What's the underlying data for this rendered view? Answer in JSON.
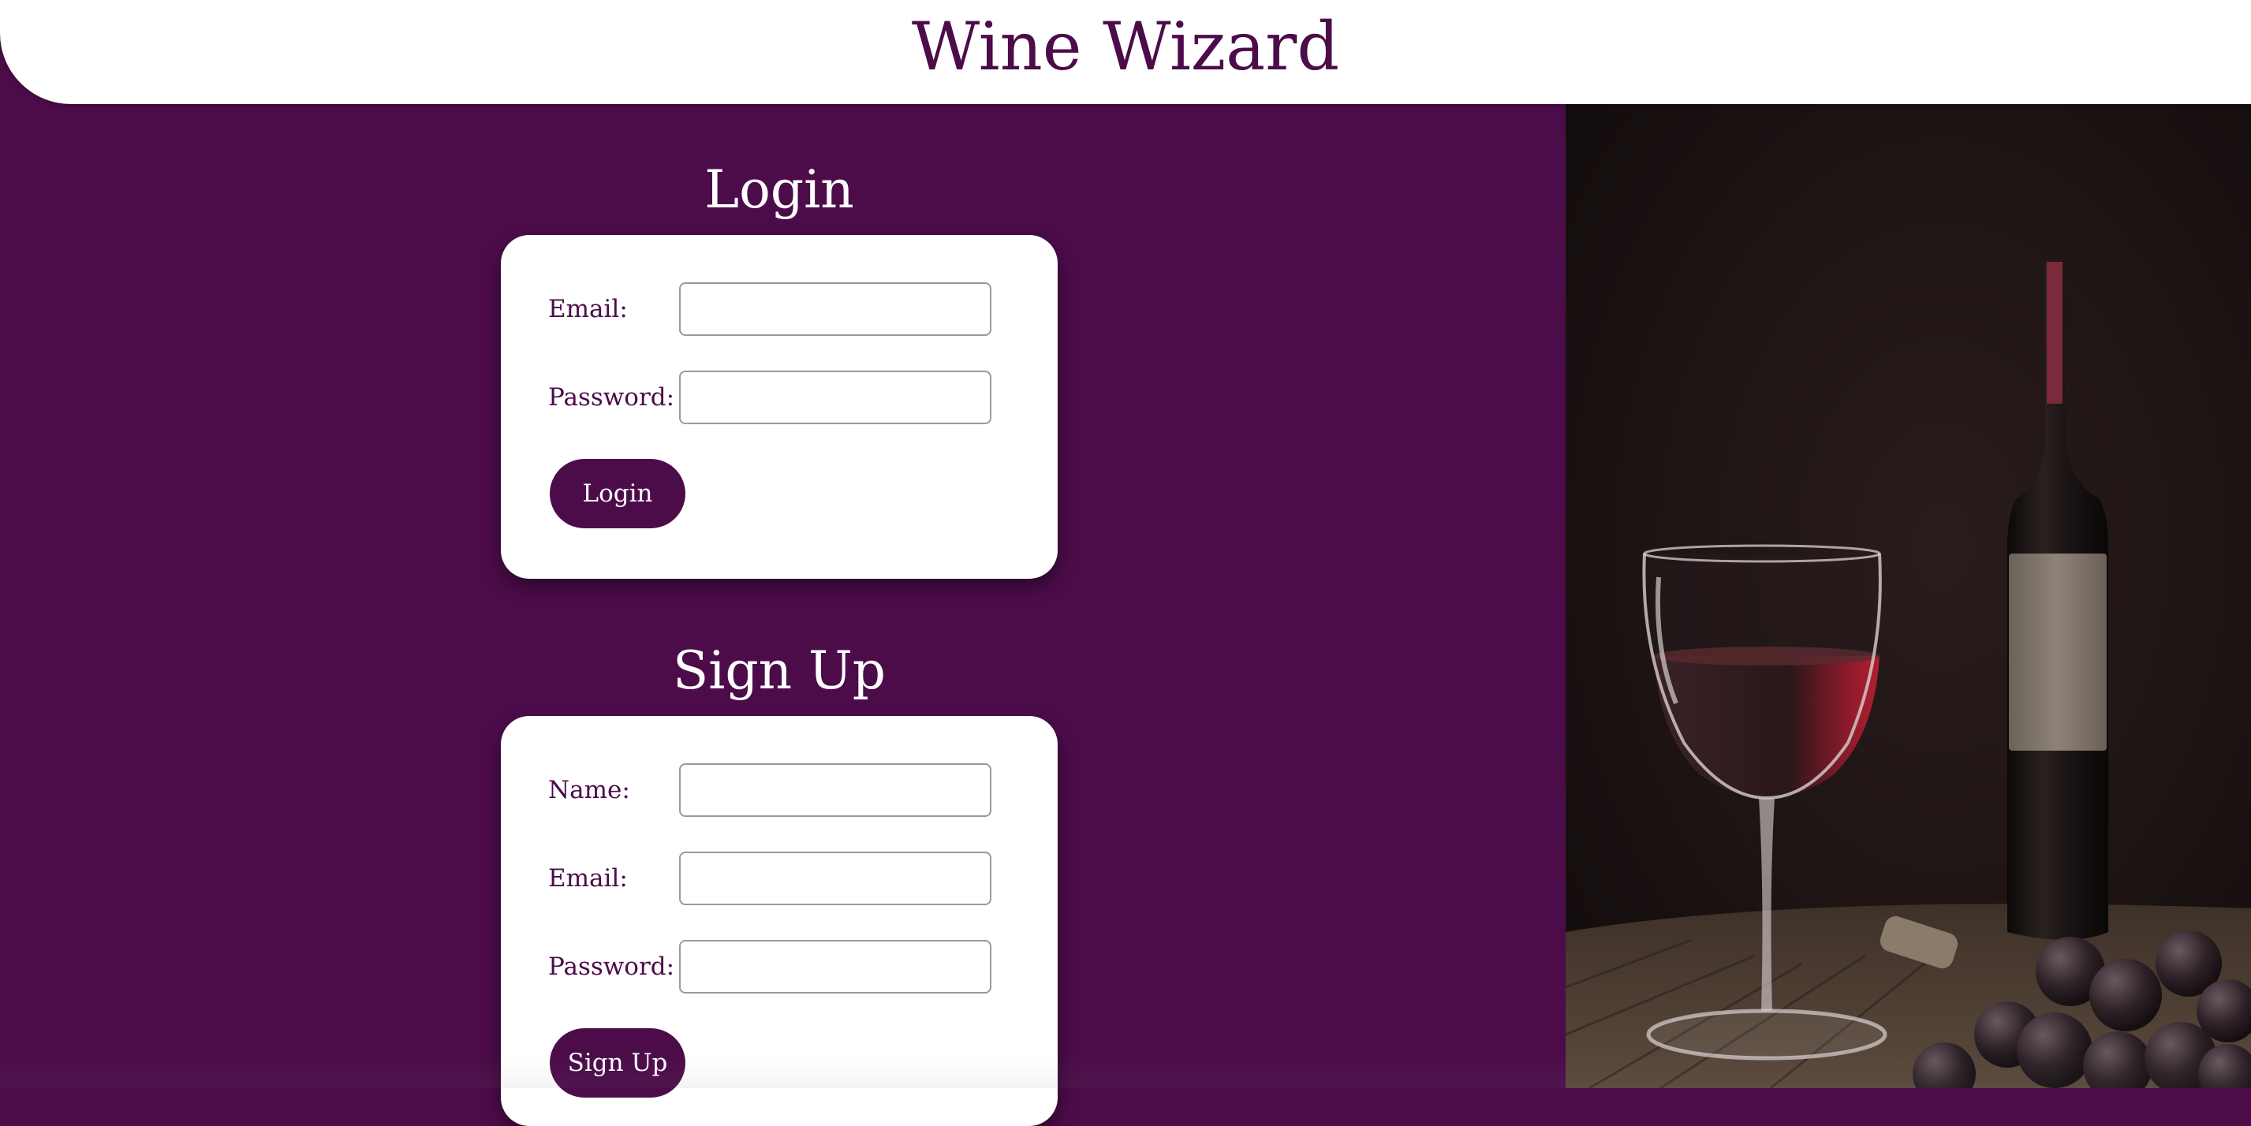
{
  "header": {
    "title": "Wine Wizard"
  },
  "login": {
    "heading": "Login",
    "email_label": "Email:",
    "email_value": "",
    "password_label": "Password:",
    "password_value": "",
    "submit_label": "Login"
  },
  "signup": {
    "heading": "Sign Up",
    "name_label": "Name:",
    "name_value": "",
    "email_label": "Email:",
    "email_value": "",
    "password_label": "Password:",
    "password_value": "",
    "submit_label": "Sign Up"
  },
  "theme": {
    "brand_color": "#4c0c4a",
    "background_color": "#4c0c4a",
    "card_color": "#ffffff"
  },
  "image": {
    "subject": "glass of red wine, wine bottle and grapes on a wooden table"
  }
}
